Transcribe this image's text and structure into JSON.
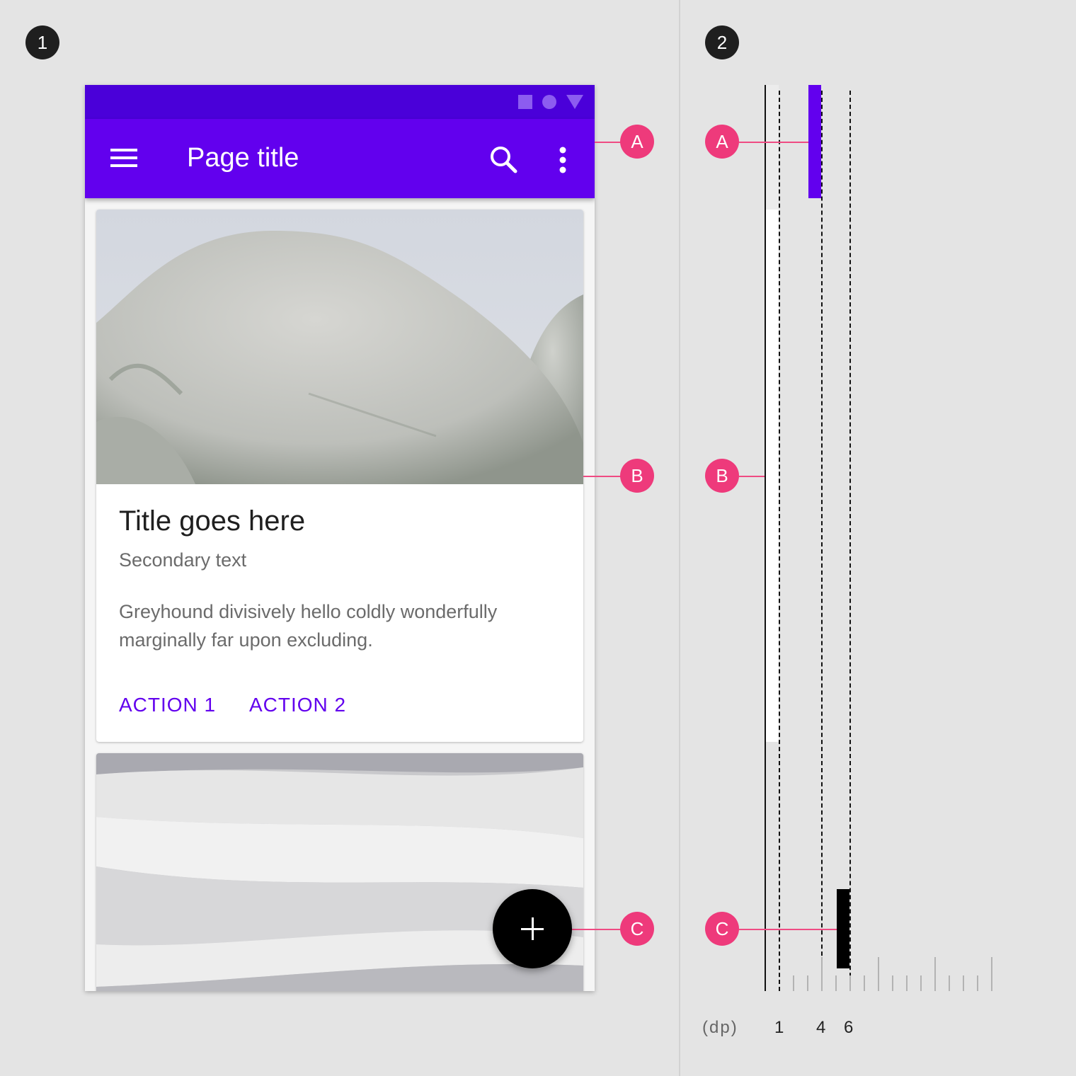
{
  "steps": {
    "first": "1",
    "second": "2"
  },
  "app_bar": {
    "title": "Page title"
  },
  "card": {
    "title": "Title goes here",
    "secondary": "Secondary text",
    "body": "Greyhound divisively hello coldly wonderfully marginally far upon excluding.",
    "action1": "ACTION 1",
    "action2": "ACTION 2"
  },
  "callouts": {
    "a": "A",
    "b": "B",
    "c": "C"
  },
  "elevation_scale": {
    "unit": "(dp)",
    "labels": [
      "1",
      "4",
      "6"
    ]
  },
  "elevations_dp": {
    "a": 4,
    "b": 1,
    "c": 6
  },
  "colors": {
    "primary": "#6200ee",
    "status_bar": "#4a00d9",
    "callout": "#ee3a7b",
    "fab": "#000000"
  },
  "icons": [
    "menu-icon",
    "search-icon",
    "more-vert-icon",
    "add-icon",
    "status-square-icon",
    "status-circle-icon",
    "status-triangle-icon"
  ]
}
